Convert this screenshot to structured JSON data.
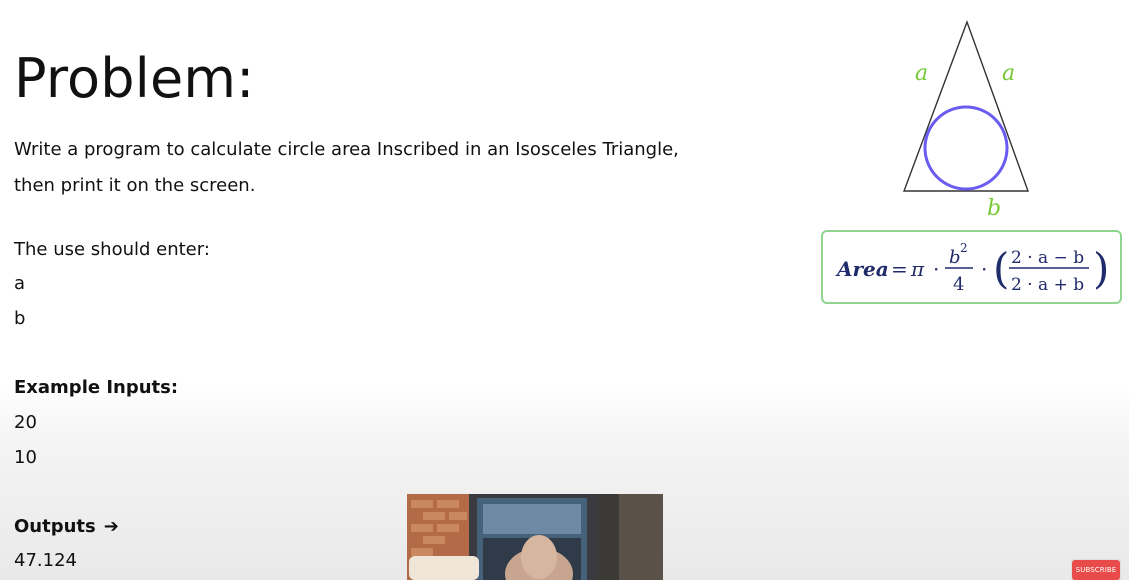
{
  "problem": {
    "title": "Problem:",
    "line1": "Write a program to calculate circle area Inscribed in an Isosceles Triangle,",
    "line2": "then print it on the screen."
  },
  "inputs": {
    "heading": "The use should enter:",
    "var_a": "a",
    "var_b": "b"
  },
  "example": {
    "heading": "Example Inputs:",
    "value_1": "20",
    "value_2": "10"
  },
  "outputs": {
    "heading": "Outputs",
    "arrow": "➔",
    "value": "47.124"
  },
  "diagram": {
    "side_label_left": "a",
    "side_label_right": "a",
    "base_label": "b",
    "triangle_color": "#333333",
    "label_color": "#77c93a",
    "circle_color": "#6a5cf0"
  },
  "formula": {
    "lhs": "Area",
    "eq": "=",
    "pi": "π",
    "dot": "·",
    "num_b": "b",
    "sup": "2",
    "den_4": "4",
    "num_expr": "2 · a − b",
    "den_expr": "2 · a + b",
    "box_border": "#8fd58f",
    "ink": "#1f2b6b"
  },
  "thumbnail": {
    "name": "presenter video thumbnail"
  },
  "subscribe": {
    "label": "SUBSCRIBE"
  }
}
